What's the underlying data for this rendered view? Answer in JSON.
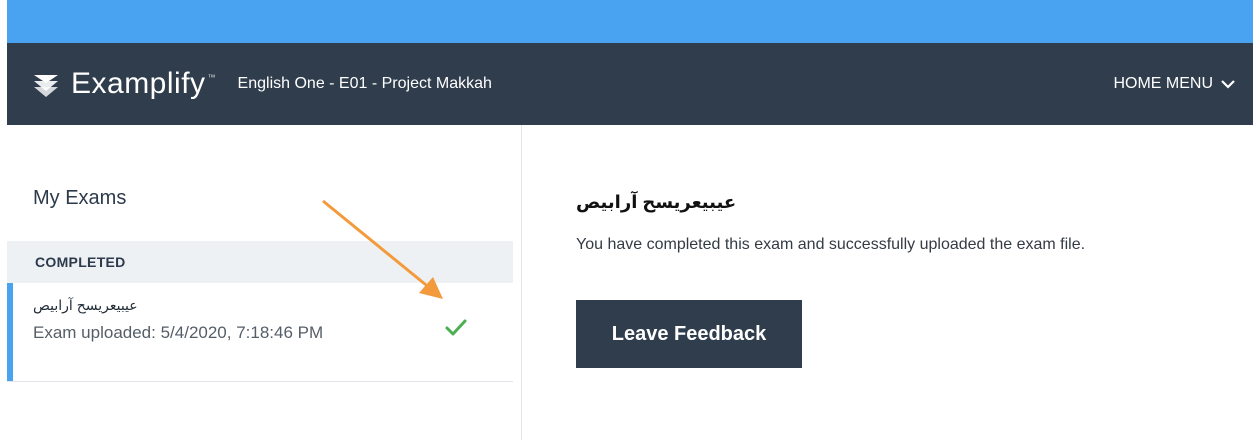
{
  "header": {
    "app_name": "Examplify",
    "trademark": "™",
    "course_title": "English One - E01 - Project Makkah",
    "home_menu_label": "HOME MENU"
  },
  "left_pane": {
    "title": "My Exams",
    "section_label": "COMPLETED",
    "exam": {
      "name": "عيبيعريسح آرابيص",
      "status": "Exam uploaded: 5/4/2020, 7:18:46 PM",
      "icon": "check-icon"
    }
  },
  "right_pane": {
    "exam_title": "عيبيعريسح آرابيص",
    "message": "You have completed this exam and successfully uploaded the exam file.",
    "feedback_button_label": "Leave Feedback"
  },
  "colors": {
    "header_bg": "#2f3d4c",
    "accent_blue": "#4aa3f0",
    "check_green": "#4caf50",
    "annotation_orange": "#f39a3c"
  }
}
